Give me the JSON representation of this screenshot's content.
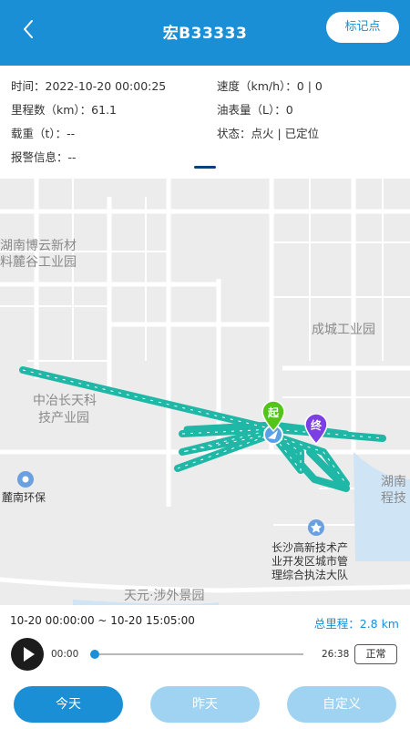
{
  "header": {
    "title": "宏B33333",
    "mark_button": "标记点"
  },
  "info": {
    "time": "时间：2022-10-20 00:00:25",
    "speed": "速度（km/h）：0 | 0",
    "mileage": "里程数（km）：61.1",
    "oil": "油表量（L）：0",
    "load": "载重（t）：--",
    "status": "状态：点火 | 已定位",
    "alarm": "报警信息：--"
  },
  "map": {
    "labels": {
      "poi1": "湖南博云新材",
      "poi1b": "料麓谷工业园",
      "poi2": "成城工业园",
      "poi3": "中冶长天科",
      "poi3b": "技产业园",
      "poi4": "麓南环保",
      "poi5": "长沙高新技术产",
      "poi5b": "业开发区城市管",
      "poi5c": "理综合执法大队",
      "poi6": "天元·涉外景园",
      "poi7": "湖南",
      "poi7b": "程技"
    },
    "start_marker": "起",
    "end_marker": "终",
    "route_color": "#1fb7a5",
    "start_color": "#52c41a",
    "end_color": "#7b3fe4"
  },
  "playback": {
    "range": "10-20 00:00:00 ~ 10-20 15:05:00",
    "total_label": "总里程：",
    "total_value": "2.8 km",
    "time_start": "00:00",
    "time_end": "26:38",
    "speed": "正常",
    "progress": 0.0
  },
  "buttons": {
    "today": "今天",
    "yesterday": "昨天",
    "custom": "自定义"
  },
  "colors": {
    "primary": "#1a8fd6",
    "light": "#9fd3f1"
  }
}
